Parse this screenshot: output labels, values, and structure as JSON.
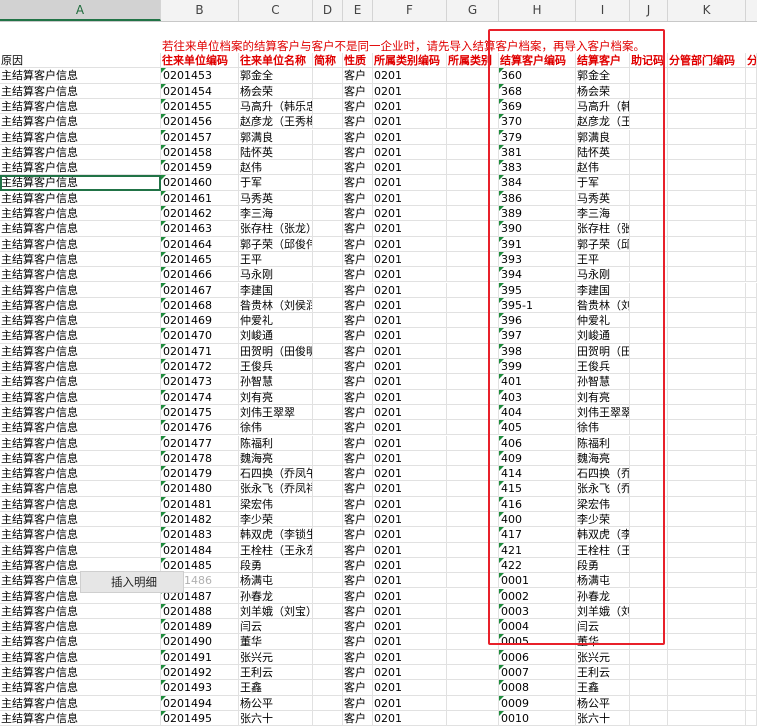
{
  "columns": [
    "A",
    "B",
    "C",
    "D",
    "E",
    "F",
    "G",
    "H",
    "I",
    "J",
    "K"
  ],
  "selected_column": "A",
  "note": "若往来单位档案的结算客户与客户不是同一企业时，请先导入结算客户档案，再导入客户档案。",
  "headers": {
    "a": "原因",
    "b": "往来单位编码",
    "c": "往来单位名称",
    "d": "简称",
    "e": "性质",
    "f": "所属类别编码",
    "g": "所属类别",
    "h": "结算客户编码",
    "i": "结算客户",
    "j": "助记码",
    "k": "分管部门编码",
    "l": "分"
  },
  "rows": [
    {
      "a": "主结算客户信息",
      "b": "0201453",
      "c": "郭金全",
      "e": "客户",
      "f": "0201",
      "h": "360",
      "i": "郭金全"
    },
    {
      "a": "主结算客户信息",
      "b": "0201454",
      "c": "杨会荣",
      "e": "客户",
      "f": "0201",
      "h": "368",
      "i": "杨会荣"
    },
    {
      "a": "主结算客户信息",
      "b": "0201455",
      "c": "马高升（韩乐忠）",
      "e": "客户",
      "f": "0201",
      "h": "369",
      "i": "马高升（韩乐忠）"
    },
    {
      "a": "主结算客户信息",
      "b": "0201456",
      "c": "赵彦龙（王秀梅）",
      "e": "客户",
      "f": "0201",
      "h": "370",
      "i": "赵彦龙（王秀梅）"
    },
    {
      "a": "主结算客户信息",
      "b": "0201457",
      "c": "郭满良",
      "e": "客户",
      "f": "0201",
      "h": "379",
      "i": "郭满良"
    },
    {
      "a": "主结算客户信息",
      "b": "0201458",
      "c": "陆怀英",
      "e": "客户",
      "f": "0201",
      "h": "381",
      "i": "陆怀英"
    },
    {
      "a": "主结算客户信息",
      "b": "0201459",
      "c": "赵伟",
      "e": "客户",
      "f": "0201",
      "h": "383",
      "i": "赵伟"
    },
    {
      "a": "主结算客户信息",
      "b": "0201460",
      "c": "于军",
      "e": "客户",
      "f": "0201",
      "h": "384",
      "i": "于军"
    },
    {
      "a": "主结算客户信息",
      "b": "0201461",
      "c": "马秀英",
      "e": "客户",
      "f": "0201",
      "h": "386",
      "i": "马秀英"
    },
    {
      "a": "主结算客户信息",
      "b": "0201462",
      "c": "李三海",
      "e": "客户",
      "f": "0201",
      "h": "389",
      "i": "李三海"
    },
    {
      "a": "主结算客户信息",
      "b": "0201463",
      "c": "张存柱（张龙）",
      "e": "客户",
      "f": "0201",
      "h": "390",
      "i": "张存柱（张龙）"
    },
    {
      "a": "主结算客户信息",
      "b": "0201464",
      "c": "郭子荣（邱俊伟）",
      "e": "客户",
      "f": "0201",
      "h": "391",
      "i": "郭子荣（邱俊伟）"
    },
    {
      "a": "主结算客户信息",
      "b": "0201465",
      "c": "王平",
      "e": "客户",
      "f": "0201",
      "h": "393",
      "i": "王平"
    },
    {
      "a": "主结算客户信息",
      "b": "0201466",
      "c": "马永刚",
      "e": "客户",
      "f": "0201",
      "h": "394",
      "i": "马永刚"
    },
    {
      "a": "主结算客户信息",
      "b": "0201467",
      "c": "李建国",
      "e": "客户",
      "f": "0201",
      "h": "395",
      "i": "李建国"
    },
    {
      "a": "主结算客户信息",
      "b": "0201468",
      "c": "昝贵林（刘侯润）",
      "e": "客户",
      "f": "0201",
      "h": "395-1",
      "i": "昝贵林（刘侯润）"
    },
    {
      "a": "主结算客户信息",
      "b": "0201469",
      "c": "仲爱礼",
      "e": "客户",
      "f": "0201",
      "h": "396",
      "i": "仲爱礼"
    },
    {
      "a": "主结算客户信息",
      "b": "0201470",
      "c": "刘峻通",
      "e": "客户",
      "f": "0201",
      "h": "397",
      "i": "刘峻通"
    },
    {
      "a": "主结算客户信息",
      "b": "0201471",
      "c": "田贺明（田俊明）",
      "e": "客户",
      "f": "0201",
      "h": "398",
      "i": "田贺明（田俊明）"
    },
    {
      "a": "主结算客户信息",
      "b": "0201472",
      "c": "王俊兵",
      "e": "客户",
      "f": "0201",
      "h": "399",
      "i": "王俊兵"
    },
    {
      "a": "主结算客户信息",
      "b": "0201473",
      "c": "孙智慧",
      "e": "客户",
      "f": "0201",
      "h": "401",
      "i": "孙智慧"
    },
    {
      "a": "主结算客户信息",
      "b": "0201474",
      "c": "刘有亮",
      "e": "客户",
      "f": "0201",
      "h": "403",
      "i": "刘有亮"
    },
    {
      "a": "主结算客户信息",
      "b": "0201475",
      "c": "刘伟王翠翠",
      "e": "客户",
      "f": "0201",
      "h": "404",
      "i": "刘伟王翠翠"
    },
    {
      "a": "主结算客户信息",
      "b": "0201476",
      "c": "徐伟",
      "e": "客户",
      "f": "0201",
      "h": "405",
      "i": "徐伟"
    },
    {
      "a": "主结算客户信息",
      "b": "0201477",
      "c": "陈福利",
      "e": "客户",
      "f": "0201",
      "h": "406",
      "i": "陈福利"
    },
    {
      "a": "主结算客户信息",
      "b": "0201478",
      "c": "魏海亮",
      "e": "客户",
      "f": "0201",
      "h": "409",
      "i": "魏海亮"
    },
    {
      "a": "主结算客户信息",
      "b": "0201479",
      "c": "石四换（乔凤午）",
      "e": "客户",
      "f": "0201",
      "h": "414",
      "i": "石四换（乔凤午）"
    },
    {
      "a": "主结算客户信息",
      "b": "0201480",
      "c": "张永飞（乔凤祥）",
      "e": "客户",
      "f": "0201",
      "h": "415",
      "i": "张永飞（乔凤祥）"
    },
    {
      "a": "主结算客户信息",
      "b": "0201481",
      "c": "梁宏伟",
      "e": "客户",
      "f": "0201",
      "h": "416",
      "i": "梁宏伟"
    },
    {
      "a": "主结算客户信息",
      "b": "0201482",
      "c": "李少荣",
      "e": "客户",
      "f": "0201",
      "h": "400",
      "i": "李少荣"
    },
    {
      "a": "主结算客户信息",
      "b": "0201483",
      "c": "韩双虎（李锁生）",
      "e": "客户",
      "f": "0201",
      "h": "417",
      "i": "韩双虎（李锁生）"
    },
    {
      "a": "主结算客户信息",
      "b": "0201484",
      "c": "王栓柱（王永东）",
      "e": "客户",
      "f": "0201",
      "h": "421",
      "i": "王栓柱（王永东）"
    },
    {
      "a": "主结算客户信息",
      "b": "0201485",
      "c": "段勇",
      "e": "客户",
      "f": "0201",
      "h": "422",
      "i": "段勇"
    },
    {
      "a": "主结算客户信息",
      "b": "0201486",
      "c": "杨满屯",
      "e": "客户",
      "f": "0201",
      "h": "0001",
      "i": "杨满屯"
    },
    {
      "a": "主结算客户信息",
      "b": "0201487",
      "c": "孙春龙",
      "e": "客户",
      "f": "0201",
      "h": "0002",
      "i": "孙春龙"
    },
    {
      "a": "主结算客户信息",
      "b": "0201488",
      "c": "刘羊娥（刘宝）",
      "e": "客户",
      "f": "0201",
      "h": "0003",
      "i": "刘羊娥（刘宝）"
    },
    {
      "a": "主结算客户信息",
      "b": "0201489",
      "c": "闫云",
      "e": "客户",
      "f": "0201",
      "h": "0004",
      "i": "闫云"
    },
    {
      "a": "主结算客户信息",
      "b": "0201490",
      "c": "董华",
      "e": "客户",
      "f": "0201",
      "h": "0005",
      "i": "董华"
    },
    {
      "a": "主结算客户信息",
      "b": "0201491",
      "c": "张兴元",
      "e": "客户",
      "f": "0201",
      "h": "0006",
      "i": "张兴元"
    },
    {
      "a": "主结算客户信息",
      "b": "0201492",
      "c": "王利云",
      "e": "客户",
      "f": "0201",
      "h": "0007",
      "i": "王利云"
    },
    {
      "a": "主结算客户信息",
      "b": "0201493",
      "c": "王鑫",
      "e": "客户",
      "f": "0201",
      "h": "0008",
      "i": "王鑫"
    },
    {
      "a": "主结算客户信息",
      "b": "0201494",
      "c": "杨公平",
      "e": "客户",
      "f": "0201",
      "h": "0009",
      "i": "杨公平"
    },
    {
      "a": "主结算客户信息",
      "b": "0201495",
      "c": "张六十",
      "e": "客户",
      "f": "0201",
      "h": "0010",
      "i": "张六十"
    }
  ],
  "context_button": "插入明细",
  "colors": {
    "accent": "#217346",
    "note_red": "#e00000",
    "highlight_box": "#e8202a"
  }
}
